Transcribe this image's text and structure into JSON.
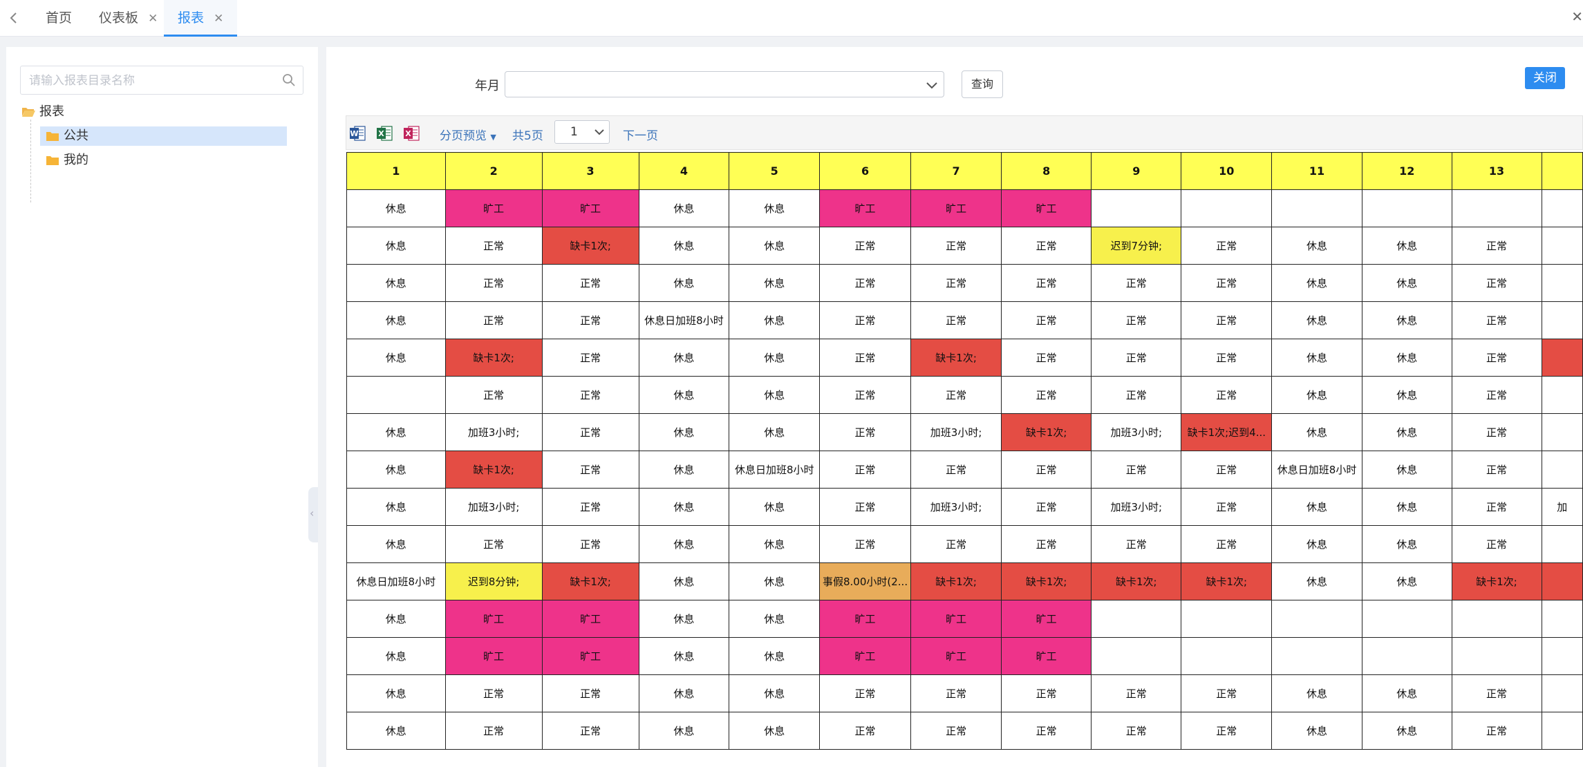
{
  "tabs": [
    {
      "label": "首页",
      "closable": false,
      "active": false
    },
    {
      "label": "仪表板",
      "closable": true,
      "active": false
    },
    {
      "label": "报表",
      "closable": true,
      "active": true
    }
  ],
  "sidebar": {
    "search_placeholder": "请输入报表目录名称",
    "tree": {
      "root": "报表",
      "children": [
        {
          "label": "公共",
          "selected": true
        },
        {
          "label": "我的",
          "selected": false
        }
      ]
    }
  },
  "query": {
    "label": "年月",
    "value": "",
    "button": "查询"
  },
  "close_button": "关闭",
  "toolbar": {
    "paging_preview": "分页预览",
    "total_pages": "共5页",
    "current_page": "1",
    "next_page": "下一页"
  },
  "colors": {
    "accent": "#2d8cf0",
    "header_yellow": "#ffff55",
    "absent_pink": "#ee338a",
    "missing_card_red": "#e44d44",
    "late_yellow": "#f7f04c",
    "leave_orange": "#e8ac5a"
  },
  "table": {
    "headers": [
      "1",
      "2",
      "3",
      "4",
      "5",
      "6",
      "7",
      "8",
      "9",
      "10",
      "11",
      "12",
      "13",
      ""
    ],
    "rows": [
      [
        {
          "t": "休息"
        },
        {
          "t": "旷工",
          "c": "pink"
        },
        {
          "t": "旷工",
          "c": "pink"
        },
        {
          "t": "休息"
        },
        {
          "t": "休息"
        },
        {
          "t": "旷工",
          "c": "pink"
        },
        {
          "t": "旷工",
          "c": "pink"
        },
        {
          "t": "旷工",
          "c": "pink"
        },
        {
          "t": ""
        },
        {
          "t": ""
        },
        {
          "t": ""
        },
        {
          "t": ""
        },
        {
          "t": ""
        },
        {
          "t": ""
        }
      ],
      [
        {
          "t": "休息"
        },
        {
          "t": "正常"
        },
        {
          "t": "缺卡1次;",
          "c": "red"
        },
        {
          "t": "休息"
        },
        {
          "t": "休息"
        },
        {
          "t": "正常"
        },
        {
          "t": "正常"
        },
        {
          "t": "正常"
        },
        {
          "t": "迟到7分钟;",
          "c": "yellow"
        },
        {
          "t": "正常"
        },
        {
          "t": "休息"
        },
        {
          "t": "休息"
        },
        {
          "t": "正常"
        },
        {
          "t": ""
        }
      ],
      [
        {
          "t": "休息"
        },
        {
          "t": "正常"
        },
        {
          "t": "正常"
        },
        {
          "t": "休息"
        },
        {
          "t": "休息"
        },
        {
          "t": "正常"
        },
        {
          "t": "正常"
        },
        {
          "t": "正常"
        },
        {
          "t": "正常"
        },
        {
          "t": "正常"
        },
        {
          "t": "休息"
        },
        {
          "t": "休息"
        },
        {
          "t": "正常"
        },
        {
          "t": ""
        }
      ],
      [
        {
          "t": "休息"
        },
        {
          "t": "正常"
        },
        {
          "t": "正常"
        },
        {
          "t": "休息日加班8小时"
        },
        {
          "t": "休息"
        },
        {
          "t": "正常"
        },
        {
          "t": "正常"
        },
        {
          "t": "正常"
        },
        {
          "t": "正常"
        },
        {
          "t": "正常"
        },
        {
          "t": "休息"
        },
        {
          "t": "休息"
        },
        {
          "t": "正常"
        },
        {
          "t": ""
        }
      ],
      [
        {
          "t": "休息"
        },
        {
          "t": "缺卡1次;",
          "c": "red"
        },
        {
          "t": "正常"
        },
        {
          "t": "休息"
        },
        {
          "t": "休息"
        },
        {
          "t": "正常"
        },
        {
          "t": "缺卡1次;",
          "c": "red"
        },
        {
          "t": "正常"
        },
        {
          "t": "正常"
        },
        {
          "t": "正常"
        },
        {
          "t": "休息"
        },
        {
          "t": "休息"
        },
        {
          "t": "正常"
        },
        {
          "t": "",
          "c": "red"
        }
      ],
      [
        {
          "t": ""
        },
        {
          "t": "正常"
        },
        {
          "t": "正常"
        },
        {
          "t": "休息"
        },
        {
          "t": "休息"
        },
        {
          "t": "正常"
        },
        {
          "t": "正常"
        },
        {
          "t": "正常"
        },
        {
          "t": "正常"
        },
        {
          "t": "正常"
        },
        {
          "t": "休息"
        },
        {
          "t": "休息"
        },
        {
          "t": "正常"
        },
        {
          "t": ""
        }
      ],
      [
        {
          "t": "休息"
        },
        {
          "t": "加班3小时;"
        },
        {
          "t": "正常"
        },
        {
          "t": "休息"
        },
        {
          "t": "休息"
        },
        {
          "t": "正常"
        },
        {
          "t": "加班3小时;"
        },
        {
          "t": "缺卡1次;",
          "c": "red"
        },
        {
          "t": "加班3小时;"
        },
        {
          "t": "缺卡1次;迟到4...",
          "c": "red"
        },
        {
          "t": "休息"
        },
        {
          "t": "休息"
        },
        {
          "t": "正常"
        },
        {
          "t": ""
        }
      ],
      [
        {
          "t": "休息"
        },
        {
          "t": "缺卡1次;",
          "c": "red"
        },
        {
          "t": "正常"
        },
        {
          "t": "休息"
        },
        {
          "t": "休息日加班8小时"
        },
        {
          "t": "正常"
        },
        {
          "t": "正常"
        },
        {
          "t": "正常"
        },
        {
          "t": "正常"
        },
        {
          "t": "正常"
        },
        {
          "t": "休息日加班8小时"
        },
        {
          "t": "休息"
        },
        {
          "t": "正常"
        },
        {
          "t": ""
        }
      ],
      [
        {
          "t": "休息"
        },
        {
          "t": "加班3小时;"
        },
        {
          "t": "正常"
        },
        {
          "t": "休息"
        },
        {
          "t": "休息"
        },
        {
          "t": "正常"
        },
        {
          "t": "加班3小时;"
        },
        {
          "t": "正常"
        },
        {
          "t": "加班3小时;"
        },
        {
          "t": "正常"
        },
        {
          "t": "休息"
        },
        {
          "t": "休息"
        },
        {
          "t": "正常"
        },
        {
          "t": "加"
        }
      ],
      [
        {
          "t": "休息"
        },
        {
          "t": "正常"
        },
        {
          "t": "正常"
        },
        {
          "t": "休息"
        },
        {
          "t": "休息"
        },
        {
          "t": "正常"
        },
        {
          "t": "正常"
        },
        {
          "t": "正常"
        },
        {
          "t": "正常"
        },
        {
          "t": "正常"
        },
        {
          "t": "休息"
        },
        {
          "t": "休息"
        },
        {
          "t": "正常"
        },
        {
          "t": ""
        }
      ],
      [
        {
          "t": "休息日加班8小时"
        },
        {
          "t": "迟到8分钟;",
          "c": "yellow"
        },
        {
          "t": "缺卡1次;",
          "c": "red"
        },
        {
          "t": "休息"
        },
        {
          "t": "休息"
        },
        {
          "t": "事假8.00小时(2...",
          "c": "orange"
        },
        {
          "t": "缺卡1次;",
          "c": "red"
        },
        {
          "t": "缺卡1次;",
          "c": "red"
        },
        {
          "t": "缺卡1次;",
          "c": "red"
        },
        {
          "t": "缺卡1次;",
          "c": "red"
        },
        {
          "t": "休息"
        },
        {
          "t": "休息"
        },
        {
          "t": "缺卡1次;",
          "c": "red"
        },
        {
          "t": "",
          "c": "red"
        }
      ],
      [
        {
          "t": "休息"
        },
        {
          "t": "旷工",
          "c": "pink"
        },
        {
          "t": "旷工",
          "c": "pink"
        },
        {
          "t": "休息"
        },
        {
          "t": "休息"
        },
        {
          "t": "旷工",
          "c": "pink"
        },
        {
          "t": "旷工",
          "c": "pink"
        },
        {
          "t": "旷工",
          "c": "pink"
        },
        {
          "t": ""
        },
        {
          "t": ""
        },
        {
          "t": ""
        },
        {
          "t": ""
        },
        {
          "t": ""
        },
        {
          "t": ""
        }
      ],
      [
        {
          "t": "休息"
        },
        {
          "t": "旷工",
          "c": "pink"
        },
        {
          "t": "旷工",
          "c": "pink"
        },
        {
          "t": "休息"
        },
        {
          "t": "休息"
        },
        {
          "t": "旷工",
          "c": "pink"
        },
        {
          "t": "旷工",
          "c": "pink"
        },
        {
          "t": "旷工",
          "c": "pink"
        },
        {
          "t": ""
        },
        {
          "t": ""
        },
        {
          "t": ""
        },
        {
          "t": ""
        },
        {
          "t": ""
        },
        {
          "t": ""
        }
      ],
      [
        {
          "t": "休息"
        },
        {
          "t": "正常"
        },
        {
          "t": "正常"
        },
        {
          "t": "休息"
        },
        {
          "t": "休息"
        },
        {
          "t": "正常"
        },
        {
          "t": "正常"
        },
        {
          "t": "正常"
        },
        {
          "t": "正常"
        },
        {
          "t": "正常"
        },
        {
          "t": "休息"
        },
        {
          "t": "休息"
        },
        {
          "t": "正常"
        },
        {
          "t": ""
        }
      ],
      [
        {
          "t": "休息"
        },
        {
          "t": "正常"
        },
        {
          "t": "正常"
        },
        {
          "t": "休息"
        },
        {
          "t": "休息"
        },
        {
          "t": "正常"
        },
        {
          "t": "正常"
        },
        {
          "t": "正常"
        },
        {
          "t": "正常"
        },
        {
          "t": "正常"
        },
        {
          "t": "休息"
        },
        {
          "t": "休息"
        },
        {
          "t": "正常"
        },
        {
          "t": ""
        }
      ]
    ]
  }
}
